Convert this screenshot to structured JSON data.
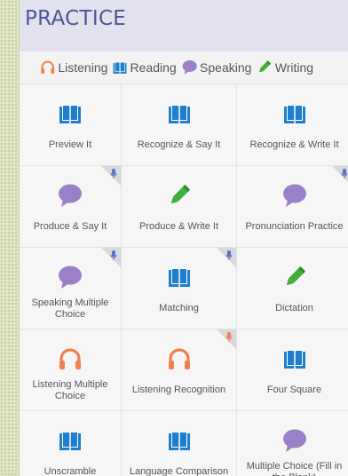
{
  "header": {
    "title": "PRACTICE"
  },
  "legend": [
    {
      "icon": "headphones-icon",
      "label": "Listening"
    },
    {
      "icon": "book-icon",
      "label": "Reading"
    },
    {
      "icon": "speech-bubble-icon",
      "label": "Speaking"
    },
    {
      "icon": "pencil-icon",
      "label": "Writing"
    }
  ],
  "colors": {
    "title": "#4e5598",
    "reading": "#1f7fcf",
    "listening": "#f08050",
    "speaking": "#9b80c8",
    "writing": "#3fae3a",
    "mic_blue": "#5a6fbf",
    "mic_orange": "#f08050"
  },
  "activities": [
    {
      "label": "Preview It",
      "icon": "book-icon",
      "mic": null
    },
    {
      "label": "Recognize & Say It",
      "icon": "book-icon",
      "mic": null
    },
    {
      "label": "Recognize & Write It",
      "icon": "book-icon",
      "mic": null
    },
    {
      "label": "Produce & Say It",
      "icon": "speech-bubble-icon",
      "mic": "blue"
    },
    {
      "label": "Produce & Write It",
      "icon": "pencil-icon",
      "mic": null
    },
    {
      "label": "Pronunciation Practice",
      "icon": "speech-bubble-icon",
      "mic": "blue"
    },
    {
      "label": "Speaking Multiple Choice",
      "icon": "speech-bubble-icon",
      "mic": "blue"
    },
    {
      "label": "Matching",
      "icon": "book-icon",
      "mic": "blue"
    },
    {
      "label": "Dictation",
      "icon": "pencil-icon",
      "mic": null
    },
    {
      "label": "Listening Multiple Choice",
      "icon": "headphones-icon",
      "mic": null
    },
    {
      "label": "Listening Recognition",
      "icon": "headphones-icon",
      "mic": "orange"
    },
    {
      "label": "Four Square",
      "icon": "book-icon",
      "mic": null
    },
    {
      "label": "Unscramble",
      "icon": "book-icon",
      "mic": null
    },
    {
      "label": "Language Comparison",
      "icon": "book-icon",
      "mic": null
    },
    {
      "label": "Multiple Choice (Fill in the Blank)",
      "icon": "speech-bubble-icon",
      "mic": null
    }
  ]
}
